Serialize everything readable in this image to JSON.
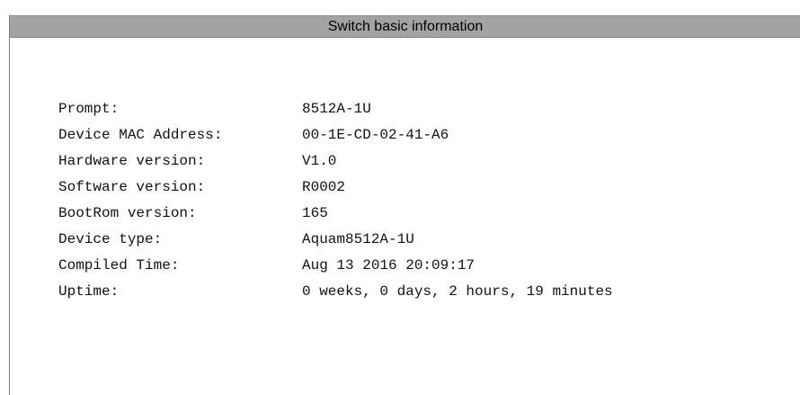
{
  "panel": {
    "title": "Switch basic information"
  },
  "info": [
    {
      "label": "Prompt:",
      "value": "8512A-1U"
    },
    {
      "label": "Device MAC Address:",
      "value": "00-1E-CD-02-41-A6"
    },
    {
      "label": "Hardware version:",
      "value": "V1.0"
    },
    {
      "label": "Software version:",
      "value": "R0002"
    },
    {
      "label": "BootRom version:",
      "value": "165"
    },
    {
      "label": "Device type:",
      "value": "Aquam8512A-1U"
    },
    {
      "label": "Compiled Time:",
      "value": "Aug 13 2016 20:09:17"
    },
    {
      "label": "Uptime:",
      "value": "0 weeks, 0 days, 2 hours, 19 minutes"
    }
  ]
}
